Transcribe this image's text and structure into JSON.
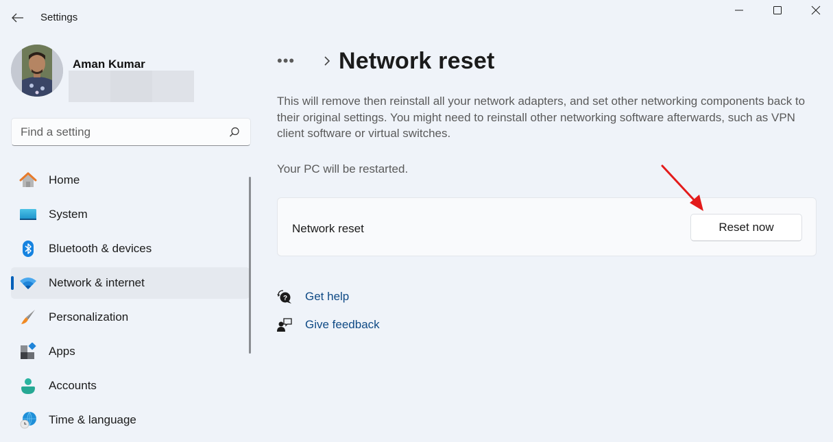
{
  "window": {
    "title": "Settings",
    "controls": {
      "minimize": "minimize",
      "maximize": "maximize",
      "close": "close"
    }
  },
  "profile": {
    "name": "Aman Kumar",
    "email_redacted": true
  },
  "search": {
    "placeholder": "Find a setting",
    "value": ""
  },
  "sidebar": {
    "items": [
      {
        "label": "Home",
        "icon": "home-icon",
        "active": false
      },
      {
        "label": "System",
        "icon": "system-icon",
        "active": false
      },
      {
        "label": "Bluetooth & devices",
        "icon": "bluetooth-icon",
        "active": false
      },
      {
        "label": "Network & internet",
        "icon": "wifi-icon",
        "active": true
      },
      {
        "label": "Personalization",
        "icon": "brush-icon",
        "active": false
      },
      {
        "label": "Apps",
        "icon": "apps-icon",
        "active": false
      },
      {
        "label": "Accounts",
        "icon": "accounts-icon",
        "active": false
      },
      {
        "label": "Time & language",
        "icon": "globe-clock-icon",
        "active": false
      }
    ]
  },
  "main": {
    "breadcrumb_more": "•••",
    "title": "Network reset",
    "description": "This will remove then reinstall all your network adapters, and set other networking components back to their original settings. You might need to reinstall other networking software afterwards, such as VPN client software or virtual switches.",
    "restart_note": "Your PC will be restarted.",
    "card": {
      "label": "Network reset",
      "button": "Reset now"
    },
    "links": [
      {
        "label": "Get help",
        "icon": "help-icon"
      },
      {
        "label": "Give feedback",
        "icon": "feedback-icon"
      }
    ]
  },
  "colors": {
    "accent": "#005fb8",
    "link": "#0f4a85",
    "annotation_arrow": "#e31b1b",
    "background": "#eff3f9"
  }
}
